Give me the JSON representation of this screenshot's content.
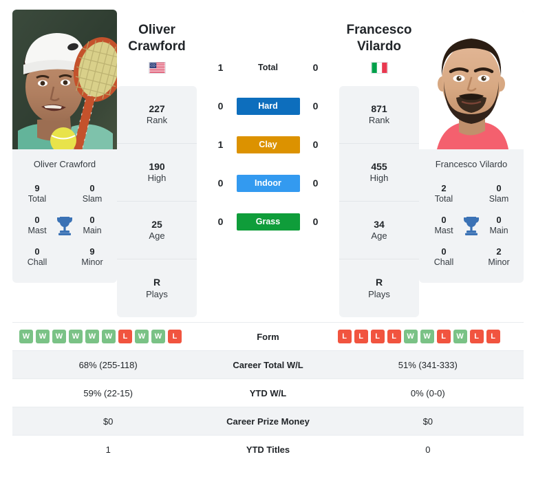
{
  "players": {
    "left": {
      "first_name": "Oliver",
      "last_name": "Crawford",
      "full_name": "Oliver Crawford",
      "country": "United States",
      "flag_icon": "flag-us",
      "rank": "227",
      "rank_label": "Rank",
      "high": "190",
      "high_label": "High",
      "age": "25",
      "age_label": "Age",
      "plays": "R",
      "plays_label": "Plays",
      "titles": {
        "total": "9",
        "total_label": "Total",
        "slam": "0",
        "slam_label": "Slam",
        "mast": "0",
        "mast_label": "Mast",
        "main": "0",
        "main_label": "Main",
        "chall": "0",
        "chall_label": "Chall",
        "minor": "9",
        "minor_label": "Minor"
      },
      "form": [
        "W",
        "W",
        "W",
        "W",
        "W",
        "W",
        "L",
        "W",
        "W",
        "L"
      ],
      "career_total_wl": "68% (255-118)",
      "ytd_wl": "59% (22-15)",
      "career_prize_money": "$0",
      "ytd_titles": "1"
    },
    "right": {
      "first_name": "Francesco",
      "last_name": "Vilardo",
      "full_name": "Francesco Vilardo",
      "country": "Italy",
      "flag_icon": "flag-it",
      "rank": "871",
      "rank_label": "Rank",
      "high": "455",
      "high_label": "High",
      "age": "34",
      "age_label": "Age",
      "plays": "R",
      "plays_label": "Plays",
      "titles": {
        "total": "2",
        "total_label": "Total",
        "slam": "0",
        "slam_label": "Slam",
        "mast": "0",
        "mast_label": "Mast",
        "main": "0",
        "main_label": "Main",
        "chall": "0",
        "chall_label": "Chall",
        "minor": "2",
        "minor_label": "Minor"
      },
      "form": [
        "L",
        "L",
        "L",
        "L",
        "W",
        "W",
        "L",
        "W",
        "L",
        "L"
      ],
      "career_total_wl": "51% (341-333)",
      "ytd_wl": "0% (0-0)",
      "career_prize_money": "$0",
      "ytd_titles": "0"
    }
  },
  "h2h": {
    "rows": [
      {
        "label": "Total",
        "left": "1",
        "right": "0",
        "style": "plain",
        "color": ""
      },
      {
        "label": "Hard",
        "left": "0",
        "right": "0",
        "style": "pill",
        "color": "#0d6ebd"
      },
      {
        "label": "Clay",
        "left": "1",
        "right": "0",
        "style": "pill",
        "color": "#dc9200"
      },
      {
        "label": "Indoor",
        "left": "0",
        "right": "0",
        "style": "pill",
        "color": "#339af0"
      },
      {
        "label": "Grass",
        "left": "0",
        "right": "0",
        "style": "pill",
        "color": "#0f9d3a"
      }
    ]
  },
  "table": {
    "rows": [
      {
        "label": "Form",
        "key": "form",
        "type": "form",
        "shaded": false
      },
      {
        "label": "Career Total W/L",
        "key": "career_total_wl",
        "type": "text",
        "shaded": true
      },
      {
        "label": "YTD W/L",
        "key": "ytd_wl",
        "type": "text",
        "shaded": false
      },
      {
        "label": "Career Prize Money",
        "key": "career_prize_money",
        "type": "text",
        "shaded": true
      },
      {
        "label": "YTD Titles",
        "key": "ytd_titles",
        "type": "text",
        "shaded": false
      }
    ]
  },
  "colors": {
    "panel_bg": "#f1f3f5",
    "win_badge": "#7ac286",
    "loss_badge": "#f1543f",
    "trophy": "#3b72b5"
  }
}
